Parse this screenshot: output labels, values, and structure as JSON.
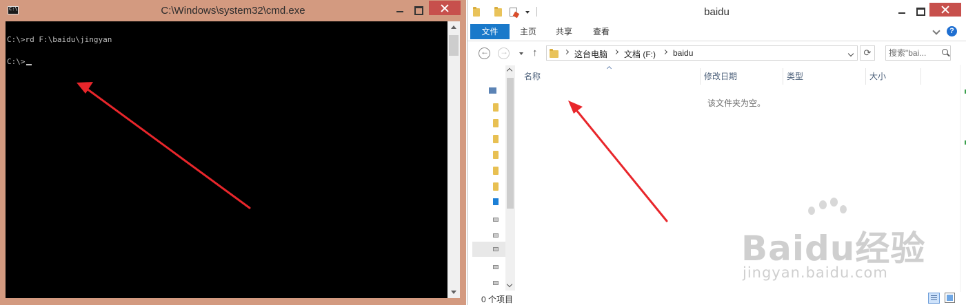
{
  "cmd": {
    "title": "C:\\Windows\\system32\\cmd.exe",
    "lines": [
      "C:\\>rd F:\\baidu\\jingyan",
      "C:\\>"
    ]
  },
  "explorer": {
    "title": "baidu",
    "ribbon": {
      "tabs": [
        "文件",
        "主页",
        "共享",
        "查看"
      ],
      "help": "?"
    },
    "address": {
      "crumbs": [
        "这台电脑",
        "文档 (F:)",
        "baidu"
      ]
    },
    "search": {
      "placeholder": "搜索\"bai..."
    },
    "columns": [
      "名称",
      "修改日期",
      "类型",
      "大小"
    ],
    "empty_message": "该文件夹为空。",
    "status": {
      "item_count": "0 个项目"
    }
  },
  "watermark": {
    "brand_text": "Baidu经验",
    "url": "jingyan.baidu.com"
  },
  "colors": {
    "close_button": "#c7504c",
    "cmd_frame": "#d39a80",
    "ribbon_file_tab": "#1979ca",
    "annotation_arrow": "#e8262b"
  },
  "icons": [
    "cmd-app-icon",
    "folder-icon",
    "document-icon",
    "back-arrow-icon",
    "forward-arrow-icon",
    "up-arrow-icon",
    "refresh-icon",
    "search-icon",
    "help-icon",
    "details-view-icon",
    "tiles-view-icon"
  ]
}
